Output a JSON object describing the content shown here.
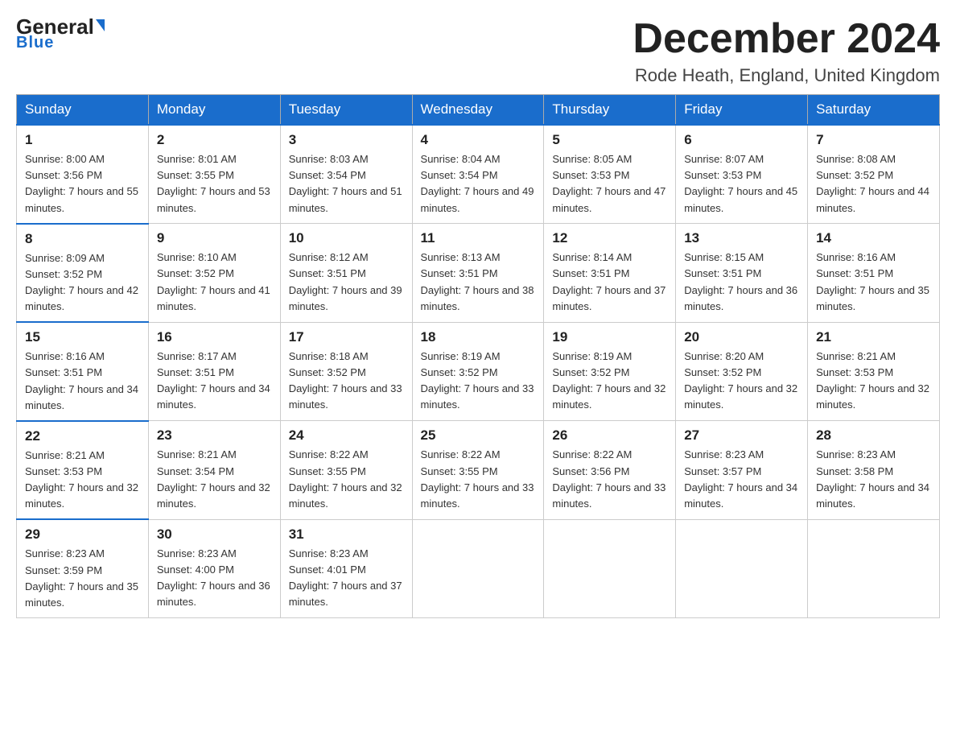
{
  "header": {
    "logo_line1": "General",
    "logo_line2": "Blue",
    "title": "December 2024",
    "subtitle": "Rode Heath, England, United Kingdom"
  },
  "days_of_week": [
    "Sunday",
    "Monday",
    "Tuesday",
    "Wednesday",
    "Thursday",
    "Friday",
    "Saturday"
  ],
  "weeks": [
    [
      {
        "day": "1",
        "sunrise": "8:00 AM",
        "sunset": "3:56 PM",
        "daylight": "7 hours and 55 minutes."
      },
      {
        "day": "2",
        "sunrise": "8:01 AM",
        "sunset": "3:55 PM",
        "daylight": "7 hours and 53 minutes."
      },
      {
        "day": "3",
        "sunrise": "8:03 AM",
        "sunset": "3:54 PM",
        "daylight": "7 hours and 51 minutes."
      },
      {
        "day": "4",
        "sunrise": "8:04 AM",
        "sunset": "3:54 PM",
        "daylight": "7 hours and 49 minutes."
      },
      {
        "day": "5",
        "sunrise": "8:05 AM",
        "sunset": "3:53 PM",
        "daylight": "7 hours and 47 minutes."
      },
      {
        "day": "6",
        "sunrise": "8:07 AM",
        "sunset": "3:53 PM",
        "daylight": "7 hours and 45 minutes."
      },
      {
        "day": "7",
        "sunrise": "8:08 AM",
        "sunset": "3:52 PM",
        "daylight": "7 hours and 44 minutes."
      }
    ],
    [
      {
        "day": "8",
        "sunrise": "8:09 AM",
        "sunset": "3:52 PM",
        "daylight": "7 hours and 42 minutes."
      },
      {
        "day": "9",
        "sunrise": "8:10 AM",
        "sunset": "3:52 PM",
        "daylight": "7 hours and 41 minutes."
      },
      {
        "day": "10",
        "sunrise": "8:12 AM",
        "sunset": "3:51 PM",
        "daylight": "7 hours and 39 minutes."
      },
      {
        "day": "11",
        "sunrise": "8:13 AM",
        "sunset": "3:51 PM",
        "daylight": "7 hours and 38 minutes."
      },
      {
        "day": "12",
        "sunrise": "8:14 AM",
        "sunset": "3:51 PM",
        "daylight": "7 hours and 37 minutes."
      },
      {
        "day": "13",
        "sunrise": "8:15 AM",
        "sunset": "3:51 PM",
        "daylight": "7 hours and 36 minutes."
      },
      {
        "day": "14",
        "sunrise": "8:16 AM",
        "sunset": "3:51 PM",
        "daylight": "7 hours and 35 minutes."
      }
    ],
    [
      {
        "day": "15",
        "sunrise": "8:16 AM",
        "sunset": "3:51 PM",
        "daylight": "7 hours and 34 minutes."
      },
      {
        "day": "16",
        "sunrise": "8:17 AM",
        "sunset": "3:51 PM",
        "daylight": "7 hours and 34 minutes."
      },
      {
        "day": "17",
        "sunrise": "8:18 AM",
        "sunset": "3:52 PM",
        "daylight": "7 hours and 33 minutes."
      },
      {
        "day": "18",
        "sunrise": "8:19 AM",
        "sunset": "3:52 PM",
        "daylight": "7 hours and 33 minutes."
      },
      {
        "day": "19",
        "sunrise": "8:19 AM",
        "sunset": "3:52 PM",
        "daylight": "7 hours and 32 minutes."
      },
      {
        "day": "20",
        "sunrise": "8:20 AM",
        "sunset": "3:52 PM",
        "daylight": "7 hours and 32 minutes."
      },
      {
        "day": "21",
        "sunrise": "8:21 AM",
        "sunset": "3:53 PM",
        "daylight": "7 hours and 32 minutes."
      }
    ],
    [
      {
        "day": "22",
        "sunrise": "8:21 AM",
        "sunset": "3:53 PM",
        "daylight": "7 hours and 32 minutes."
      },
      {
        "day": "23",
        "sunrise": "8:21 AM",
        "sunset": "3:54 PM",
        "daylight": "7 hours and 32 minutes."
      },
      {
        "day": "24",
        "sunrise": "8:22 AM",
        "sunset": "3:55 PM",
        "daylight": "7 hours and 32 minutes."
      },
      {
        "day": "25",
        "sunrise": "8:22 AM",
        "sunset": "3:55 PM",
        "daylight": "7 hours and 33 minutes."
      },
      {
        "day": "26",
        "sunrise": "8:22 AM",
        "sunset": "3:56 PM",
        "daylight": "7 hours and 33 minutes."
      },
      {
        "day": "27",
        "sunrise": "8:23 AM",
        "sunset": "3:57 PM",
        "daylight": "7 hours and 34 minutes."
      },
      {
        "day": "28",
        "sunrise": "8:23 AM",
        "sunset": "3:58 PM",
        "daylight": "7 hours and 34 minutes."
      }
    ],
    [
      {
        "day": "29",
        "sunrise": "8:23 AM",
        "sunset": "3:59 PM",
        "daylight": "7 hours and 35 minutes."
      },
      {
        "day": "30",
        "sunrise": "8:23 AM",
        "sunset": "4:00 PM",
        "daylight": "7 hours and 36 minutes."
      },
      {
        "day": "31",
        "sunrise": "8:23 AM",
        "sunset": "4:01 PM",
        "daylight": "7 hours and 37 minutes."
      },
      null,
      null,
      null,
      null
    ]
  ]
}
